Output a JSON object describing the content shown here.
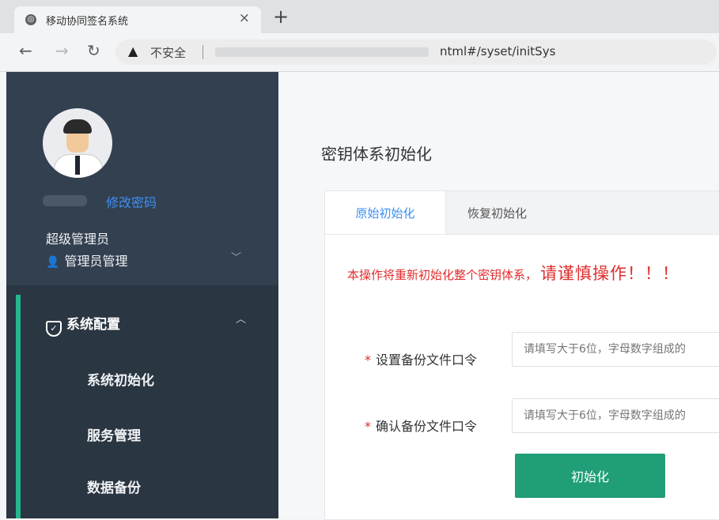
{
  "browser": {
    "tab_title": "移动协同签名系统",
    "close_glyph": "×",
    "new_tab_glyph": "+",
    "security_label": "不安全",
    "url_visible": "ntml#/syset/initSys"
  },
  "sidebar": {
    "change_password": "修改密码",
    "role": "超级管理员",
    "admin_menu": "管理员管理",
    "system_config": "系统配置",
    "items": [
      {
        "label": "系统初始化"
      },
      {
        "label": "服务管理"
      },
      {
        "label": "数据备份"
      }
    ]
  },
  "main": {
    "page_title": "密钥体系初始化",
    "tabs": [
      {
        "label": "原始初始化"
      },
      {
        "label": "恢复初始化"
      }
    ],
    "warning_text": "本操作将重新初始化整个密钥体系，",
    "warning_emphasis": "请谨慎操作！！！",
    "form": {
      "backup_password_label": "设置备份文件口令",
      "backup_password_placeholder": "请填写大于6位，字母数字组成的",
      "confirm_password_label": "确认备份文件口令",
      "confirm_password_placeholder": "请填写大于6位，字母数字组成的"
    },
    "init_button": "初始化"
  },
  "colors": {
    "sidebar_bg": "#2a3642",
    "accent_green": "#1f9e78",
    "active_tab_blue": "#3d8ff3",
    "warning_red": "#e12c2c"
  },
  "icons": [
    "globe-icon",
    "back-arrow-icon",
    "forward-arrow-icon",
    "reload-icon",
    "warning-triangle-icon",
    "user-avatar",
    "person-icon",
    "shield-check-icon",
    "chevron-down-icon",
    "chevron-up-icon"
  ]
}
